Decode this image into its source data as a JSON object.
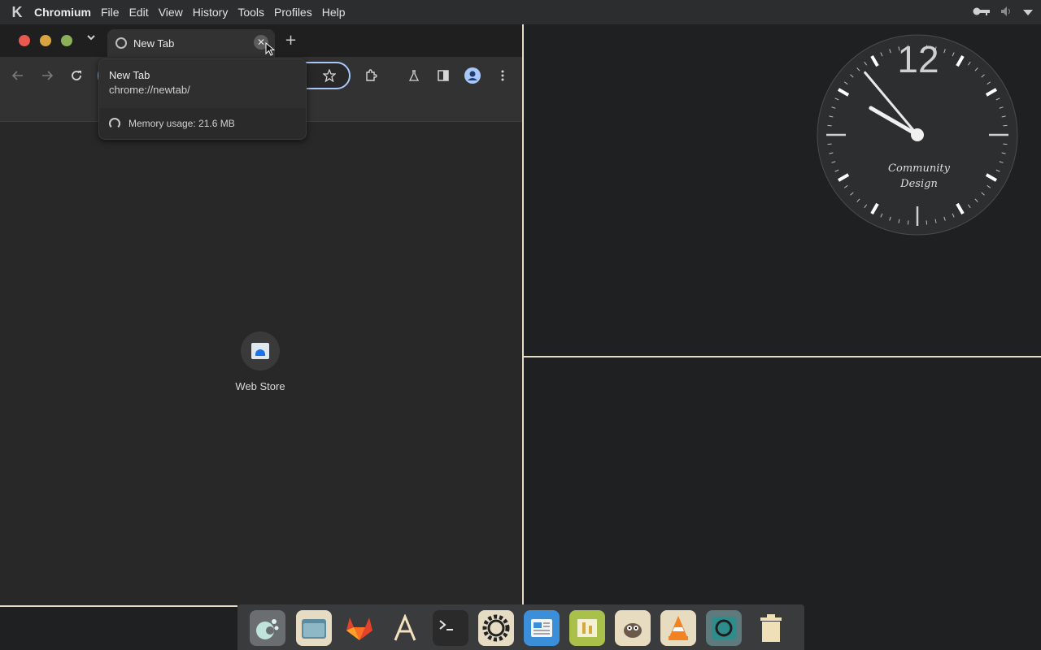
{
  "menubar": {
    "app_name": "Chromium",
    "menus": [
      "File",
      "Edit",
      "View",
      "History",
      "Tools",
      "Profiles",
      "Help"
    ]
  },
  "browser": {
    "tab": {
      "title": "New Tab"
    },
    "hovercard": {
      "title": "New Tab",
      "url": "chrome://newtab/",
      "memory": "Memory usage: 21.6 MB"
    },
    "newtab_page": {
      "shortcut_label": "Web Store"
    }
  },
  "clock": {
    "twelve": "12",
    "label_line1": "Community",
    "label_line2": "Design",
    "hour_hand_deg": 300,
    "minute_hand_deg": 320
  },
  "dock": {
    "items": [
      "app-launcher",
      "file-manager",
      "gitlab",
      "font-viewer",
      "terminal",
      "settings",
      "news-reader",
      "spreadsheet",
      "gimp",
      "vlc",
      "chromium",
      "trash"
    ]
  },
  "colors": {
    "accent_border": "#e6dcc4",
    "omnibox_focus": "#a8c7fa"
  }
}
